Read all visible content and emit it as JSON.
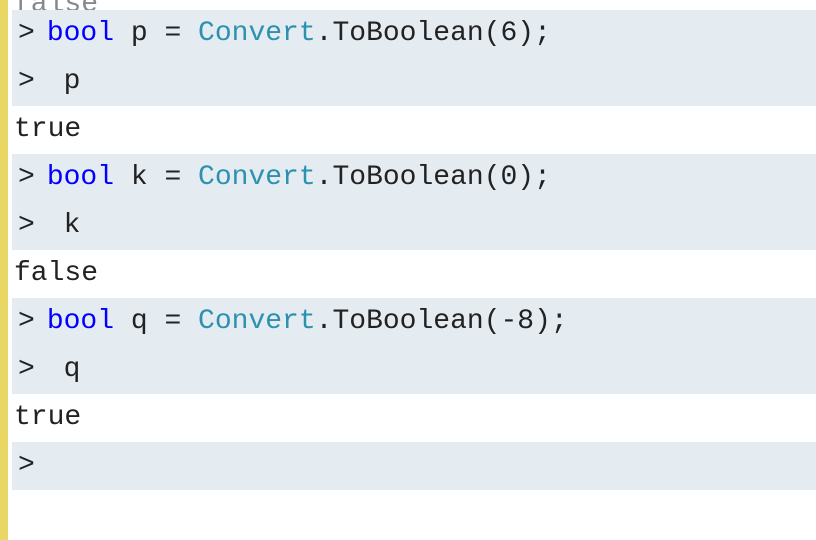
{
  "lines": {
    "l0_partial": "false",
    "l1_prompt": ">",
    "l1_kw": "bool",
    "l1_sp1": " p = ",
    "l1_cls": "Convert",
    "l1_rest": ".ToBoolean(6);",
    "l2_prompt": ">",
    "l2_text": " p",
    "l3_out": "true",
    "l4_prompt": ">",
    "l4_kw": "bool",
    "l4_sp1": " k = ",
    "l4_cls": "Convert",
    "l4_rest": ".ToBoolean(0);",
    "l5_prompt": ">",
    "l5_text": " k",
    "l6_out": "false",
    "l7_prompt": ">",
    "l7_kw": "bool",
    "l7_sp1": " q = ",
    "l7_cls": "Convert",
    "l7_rest": ".ToBoolean(-8);",
    "l8_prompt": ">",
    "l8_text": " q",
    "l9_out": "true",
    "l10_prompt": ">"
  }
}
